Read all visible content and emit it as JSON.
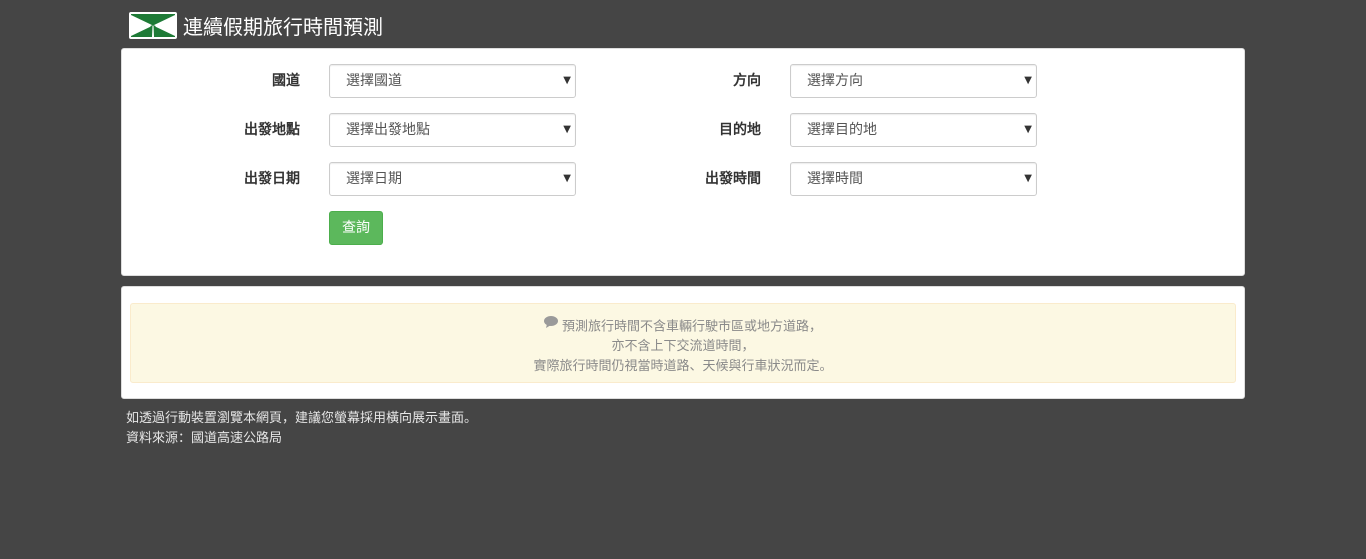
{
  "header": {
    "title": "連續假期旅行時間預測",
    "logo_icon": "highway-logo-icon"
  },
  "form": {
    "highway": {
      "label": "國道",
      "value": "選擇國道"
    },
    "direction": {
      "label": "方向",
      "value": "選擇方向"
    },
    "origin": {
      "label": "出發地點",
      "value": "選擇出發地點"
    },
    "destination": {
      "label": "目的地",
      "value": "選擇目的地"
    },
    "date": {
      "label": "出發日期",
      "value": "選擇日期"
    },
    "time": {
      "label": "出發時間",
      "value": "選擇時間"
    },
    "caret": "▼",
    "query_label": "查詢"
  },
  "notice": {
    "icon": "comment-icon",
    "lines": [
      "預測旅行時間不含車輛行駛市區或地方道路，",
      "亦不含上下交流道時間，",
      "實際旅行時間仍視當時道路、天候與行車狀況而定。"
    ]
  },
  "footer": {
    "line1": "如透過行動裝置瀏覽本網頁，建議您螢幕採用橫向展示畫面。",
    "line2": "資料來源：國道高速公路局"
  },
  "colors": {
    "background": "#454545",
    "primary_button": "#5cb85c",
    "logo_green": "#1e7a36",
    "alert_background": "#fcf8e3"
  }
}
